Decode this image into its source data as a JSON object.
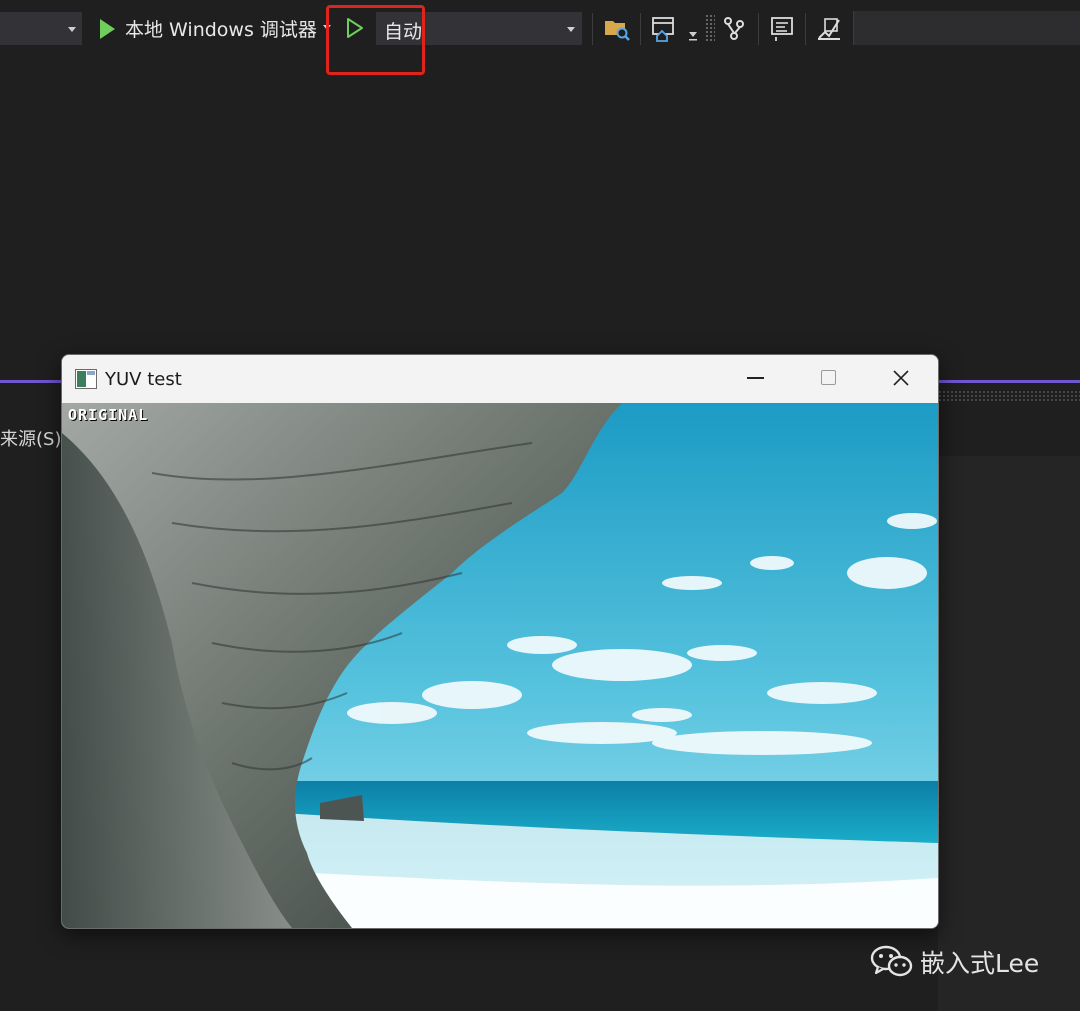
{
  "toolbar": {
    "run_label": "本地 Windows 调试器",
    "config_value": "自动",
    "icons": [
      "folder-search-icon",
      "browser-home-icon",
      "git-branch-icon",
      "code-map-icon",
      "profiler-icon"
    ]
  },
  "panel": {
    "side_label": "来源(S)"
  },
  "window": {
    "title": "YUV test",
    "overlay_label": "ORIGINAL"
  },
  "watermark": {
    "text": "嵌入式Lee"
  },
  "colors": {
    "background": "#1f1f1f",
    "accent_purple": "#6e56cf",
    "highlight_red": "#e0231b",
    "run_green": "#6fcf5c"
  }
}
